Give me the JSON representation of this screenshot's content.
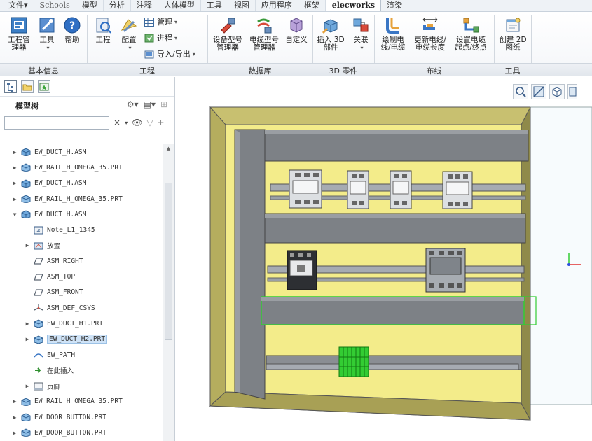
{
  "menu": {
    "tabs": [
      "文件▾",
      "Schools",
      "模型",
      "分析",
      "注释",
      "人体模型",
      "工具",
      "视图",
      "应用程序",
      "框架",
      "elecworks",
      "渲染"
    ],
    "active": "elecworks"
  },
  "ribbon": {
    "groups": {
      "basic": "基本信息",
      "project": "工程",
      "database": "数据库",
      "parts3d": "3D 零件",
      "routing": "布线",
      "tools": "工具"
    },
    "buttons": {
      "project_manager": "工程管\n理器",
      "tools": "工具",
      "help": "帮助",
      "project": "工程",
      "config": "配置",
      "manage": "管理",
      "process": "进程",
      "import_export": "导入/导出",
      "device_model_mgr": "设备型号\n管理器",
      "cable_model_mgr": "电缆型号\n管理器",
      "custom": "自定义",
      "insert_3d_part": "插入 3D\n部件",
      "associate": "关联",
      "draw_wire": "绘制电\n线/电缆",
      "update_wire_length": "更新电线/\n电缆长度",
      "set_cable_endpoints": "设置电缆\n起点/终点",
      "create_2d_drawing": "创建 2D\n图纸"
    }
  },
  "left_panel": {
    "title": "模型树",
    "search_placeholder": "",
    "tree": [
      {
        "label": "EW_DUCT_H.ASM",
        "icon": "assembly-icon",
        "expanded": false,
        "indent": 0,
        "selected": false
      },
      {
        "label": "EW_RAIL_H_OMEGA_35.PRT",
        "icon": "part-icon",
        "expanded": false,
        "indent": 0,
        "selected": false
      },
      {
        "label": "EW_DUCT_H.ASM",
        "icon": "assembly-icon",
        "expanded": false,
        "indent": 0,
        "selected": false
      },
      {
        "label": "EW_RAIL_H_OMEGA_35.PRT",
        "icon": "part-icon",
        "expanded": false,
        "indent": 0,
        "selected": false
      },
      {
        "label": "EW_DUCT_H.ASM",
        "icon": "assembly-icon",
        "expanded": true,
        "indent": 0,
        "selected": false
      },
      {
        "label": "Note_L1_1345",
        "icon": "note-icon",
        "expanded": null,
        "indent": 1,
        "selected": false
      },
      {
        "label": "放置",
        "icon": "placement-icon",
        "expanded": false,
        "indent": 1,
        "selected": false
      },
      {
        "label": "ASM_RIGHT",
        "icon": "datum-plane-icon",
        "expanded": null,
        "indent": 1,
        "selected": false
      },
      {
        "label": "ASM_TOP",
        "icon": "datum-plane-icon",
        "expanded": null,
        "indent": 1,
        "selected": false
      },
      {
        "label": "ASM_FRONT",
        "icon": "datum-plane-icon",
        "expanded": null,
        "indent": 1,
        "selected": false
      },
      {
        "label": "ASM_DEF_CSYS",
        "icon": "csys-icon",
        "expanded": null,
        "indent": 1,
        "selected": false
      },
      {
        "label": "EW_DUCT_H1.PRT",
        "icon": "part-icon",
        "expanded": false,
        "indent": 1,
        "selected": false
      },
      {
        "label": "EW_DUCT_H2.PRT",
        "icon": "part-icon",
        "expanded": false,
        "indent": 1,
        "selected": true
      },
      {
        "label": "EW_PATH",
        "icon": "path-icon",
        "expanded": null,
        "indent": 1,
        "selected": false
      },
      {
        "label": "在此插入",
        "icon": "insert-here-icon",
        "expanded": null,
        "indent": 1,
        "selected": false
      },
      {
        "label": "页脚",
        "icon": "footer-icon",
        "expanded": false,
        "indent": 1,
        "selected": false
      },
      {
        "label": "EW_RAIL_H_OMEGA_35.PRT",
        "icon": "part-icon",
        "expanded": false,
        "indent": 0,
        "selected": false
      },
      {
        "label": "EW_DOOR_BUTTON.PRT",
        "icon": "part-icon",
        "expanded": false,
        "indent": 0,
        "selected": false
      },
      {
        "label": "EW_DOOR_BUTTON.PRT",
        "icon": "part-icon",
        "expanded": false,
        "indent": 0,
        "selected": false
      }
    ]
  },
  "colors": {
    "cabinet_outer": "#c8c070",
    "cabinet_inner": "#f3ec8a",
    "duct": "#7d8186",
    "rail": "#a6abb2",
    "terminal_block": "#33cc33",
    "selection": "#33cc33"
  }
}
